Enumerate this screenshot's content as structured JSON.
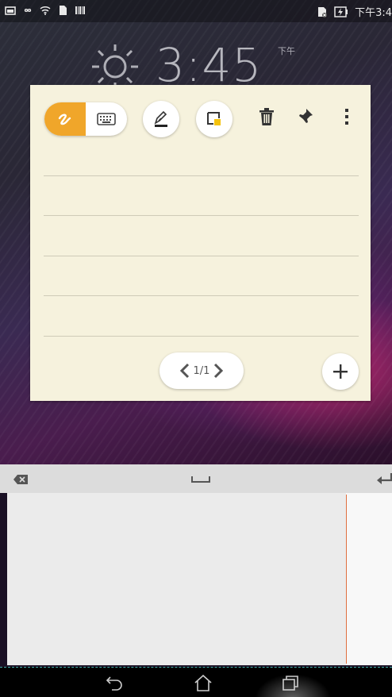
{
  "status_bar": {
    "time": "下午3:4",
    "icons": [
      "picture-icon",
      "infinity-icon",
      "wifi-icon",
      "sd-card-icon",
      "barcode-icon",
      "sim-icon",
      "battery-charging-icon"
    ]
  },
  "lockscreen": {
    "weather_icon": "sun-icon",
    "time": "3:45",
    "ampm": "下午"
  },
  "note": {
    "toolbar": {
      "handwriting_icon": "handwriting-icon",
      "keyboard_icon": "keyboard-icon",
      "pen_settings_icon": "pen-settings-icon",
      "note_color_icon": "note-color-icon",
      "delete_icon": "trash-icon",
      "pin_icon": "pin-icon",
      "more_icon": "more-vert-icon"
    },
    "page_indicator": "1/1",
    "add_icon": "plus-icon",
    "accent": "#f0a62a",
    "paper": "#f6f2dd"
  },
  "input_panel": {
    "backspace_icon": "backspace-icon",
    "space_icon": "space-icon",
    "enter_icon": "enter-icon"
  },
  "nav": {
    "back_icon": "back-icon",
    "home_icon": "home-icon",
    "recents_icon": "recents-icon"
  }
}
